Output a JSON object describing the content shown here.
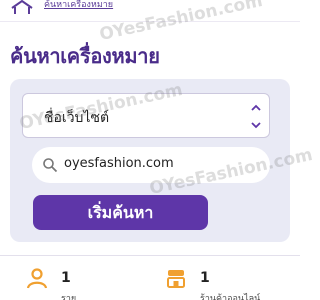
{
  "header": {
    "breadcrumb": "ค้นหาเครื่องหมาย"
  },
  "page": {
    "title": "ค้นหาเครื่องหมาย"
  },
  "search": {
    "type_select_value": "ชื่อเว็บไซต์",
    "url_value": "oyesfashion.com",
    "start_button_label": "เริ่มค้นหา"
  },
  "stats": [
    {
      "value": "1",
      "label": "ราย",
      "icon": "user-icon"
    },
    {
      "value": "1",
      "label": "ร้านค้าออนไลน์",
      "icon": "store-icon"
    }
  ],
  "watermark": "OYesFashion.com",
  "colors": {
    "brand_purple": "#4a2c8a",
    "button_purple": "#5e36a8",
    "card_background": "#e9eaf5",
    "icon_orange": "#f0a030"
  }
}
